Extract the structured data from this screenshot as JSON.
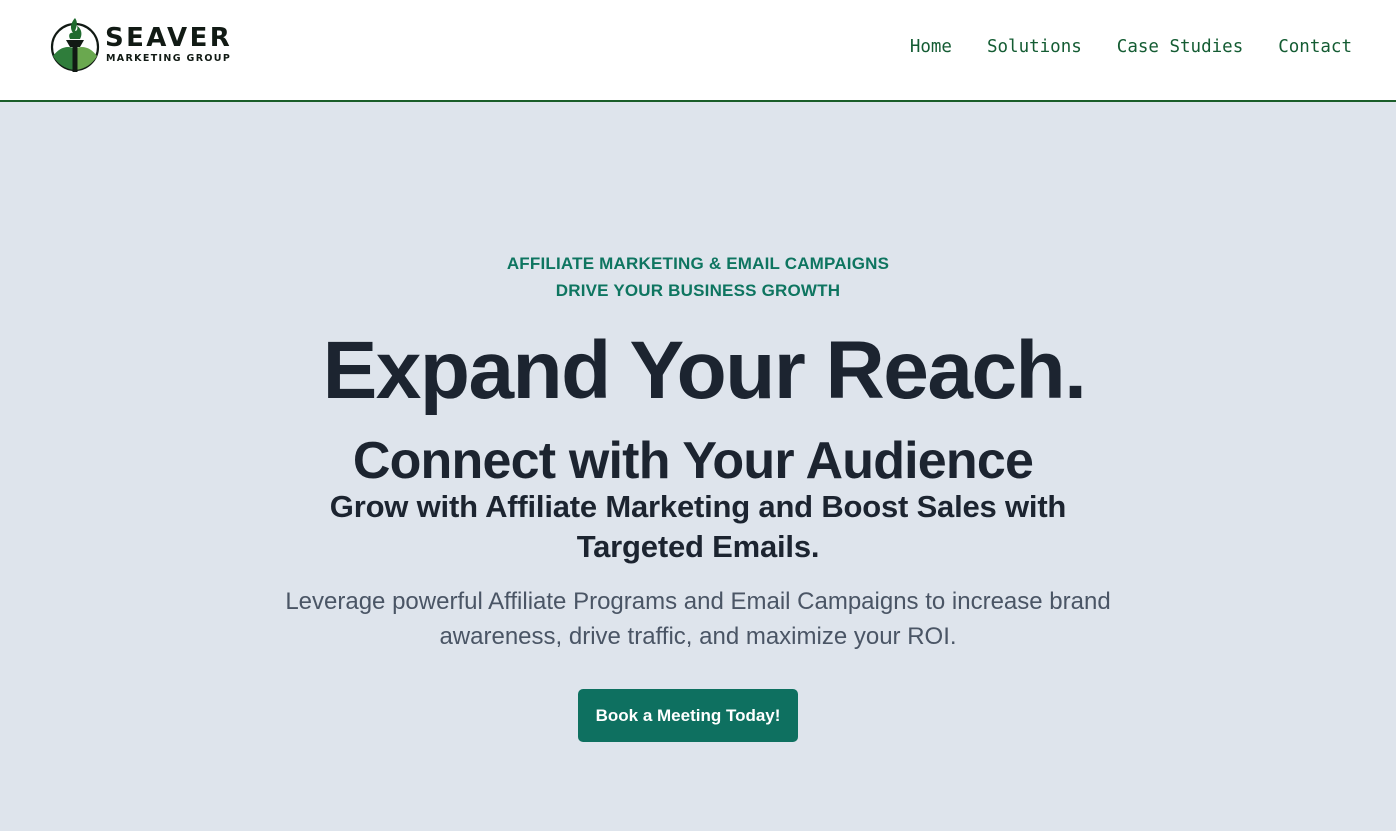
{
  "header": {
    "logo": {
      "name": "SEAVER",
      "tagline": "MARKETING GROUP",
      "icon": "torch-icon"
    },
    "nav": [
      {
        "label": "Home"
      },
      {
        "label": "Solutions"
      },
      {
        "label": "Case Studies"
      },
      {
        "label": "Contact"
      }
    ]
  },
  "hero": {
    "eyebrow_line1": "AFFILIATE MARKETING & EMAIL CAMPAIGNS",
    "eyebrow_line2": "DRIVE YOUR BUSINESS GROWTH",
    "headline": "Expand Your Reach.",
    "subheadline": "Connect with Your Audience",
    "tagline": "Grow with Affiliate Marketing and Boost Sales with Targeted Emails.",
    "description": "Leverage powerful Affiliate Programs and Email Campaigns to increase brand awareness, drive traffic, and maximize your ROI.",
    "cta_label": "Book a Meeting Today!"
  },
  "colors": {
    "brand_green": "#145c33",
    "accent_teal": "#0e7060",
    "hero_background": "#dee4ec",
    "heading_text": "#1c2430",
    "body_text": "#4a5565"
  }
}
